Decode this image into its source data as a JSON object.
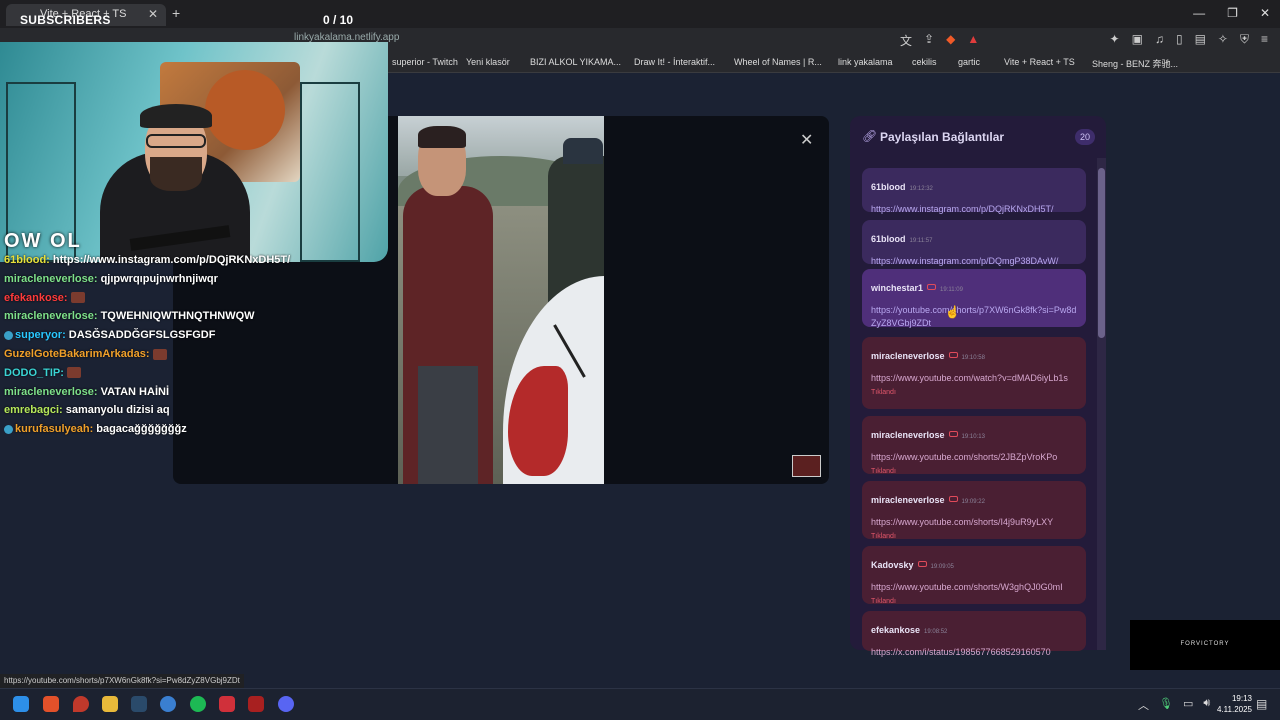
{
  "browser": {
    "tab_title": "Vite + React + TS",
    "url": "linkyakalama.netlify.app",
    "status_url": "https://youtube.com/shorts/p7XW6nGk8fk?si=Pw8dZyZ8VGbj9ZDt"
  },
  "overlay": {
    "subscribers_label": "SUBSCRIBERS",
    "counter": "0 / 10",
    "webcam_text": "OW OL",
    "corner_brand": "FORVICTORY"
  },
  "bookmarks": [
    {
      "label": "superior - Twitch"
    },
    {
      "label": "Yeni klasör"
    },
    {
      "label": "BIZI ALKOL YIKAMA..."
    },
    {
      "label": "Draw It! - İnteraktif..."
    },
    {
      "label": "Wheel of Names | R..."
    },
    {
      "label": "link yakalama"
    },
    {
      "label": "cekilis"
    },
    {
      "label": "gartic"
    },
    {
      "label": "Vite + React + TS"
    },
    {
      "label": "Sheng - BENZ 奔驰..."
    }
  ],
  "chat": [
    {
      "user": "61blood:",
      "msg": "https://www.instagram.com/p/DQjRKNxDH5T/",
      "color": "#e8e03a"
    },
    {
      "user": "miracleneverlose:",
      "msg": "qjıpwrqıpujnwrhnjiwqr",
      "color": "#7ee08a"
    },
    {
      "user": "efekankose:",
      "msg": "",
      "color": "#ff3b3b",
      "emote": true
    },
    {
      "user": "miracleneverlose:",
      "msg": "TQWEHNIQWTHNQTHNWQW",
      "color": "#7ee08a"
    },
    {
      "user": "superyor:",
      "msg": "DASĞSADDĞGFSLGSFGDF",
      "color": "#29c7ff",
      "badge": true
    },
    {
      "user": "GuzelGoteBakarimArkadas:",
      "msg": "",
      "color": "#f0a02a",
      "emote": true
    },
    {
      "user": "DODO_TIP:",
      "msg": "",
      "color": "#3ad4d4",
      "emote": true
    },
    {
      "user": "miracleneverlose:",
      "msg": "VATAN HAİNİ",
      "color": "#7ee08a"
    },
    {
      "user": "emrebagci:",
      "msg": "samanyolu dizisi aq",
      "color": "#b6e85a"
    },
    {
      "user": "kurufasulyeah:",
      "msg": "bagacağğğğğğğz",
      "color": "#f0a02a",
      "badge": true
    }
  ],
  "panel": {
    "title": "Paylaşılan Bağlantılar",
    "count": "20",
    "clicked_label": "Tıklandı",
    "cards": [
      {
        "user": "61blood",
        "time": "19:12:32",
        "url": "https://www.instagram.com/p/DQjRKNxDH5T/",
        "yt": false,
        "clicked": false,
        "style": "purple"
      },
      {
        "user": "61blood",
        "time": "19:11:57",
        "url": "https://www.instagram.com/p/DQmgP38DAvW/",
        "yt": false,
        "clicked": false,
        "style": "purple"
      },
      {
        "user": "winchestar1",
        "time": "19:11:09",
        "url": "https://youtube.com/shorts/p7XW6nGk8fk?si=Pw8dZyZ8VGbj9ZDt",
        "yt": true,
        "clicked": false,
        "style": "purple active"
      },
      {
        "user": "miracleneverlose",
        "time": "19:10:58",
        "url": "https://www.youtube.com/watch?v=dMAD6iyLb1s",
        "yt": true,
        "clicked": true,
        "style": "red"
      },
      {
        "user": "miracleneverlose",
        "time": "19:10:13",
        "url": "https://www.youtube.com/shorts/2JBZpVroKPo",
        "yt": true,
        "clicked": true,
        "style": "red"
      },
      {
        "user": "miracleneverlose",
        "time": "19:09:22",
        "url": "https://www.youtube.com/shorts/I4j9uR9yLXY",
        "yt": true,
        "clicked": true,
        "style": "red"
      },
      {
        "user": "Kadovsky",
        "time": "19:09:05",
        "url": "https://www.youtube.com/shorts/W3ghQJ0G0mI",
        "yt": true,
        "clicked": true,
        "style": "red"
      },
      {
        "user": "efekankose",
        "time": "19:08:52",
        "url": "https://x.com/i/status/1985677668529160570",
        "yt": false,
        "clicked": false,
        "style": "red"
      }
    ]
  },
  "clock": {
    "time": "19:13",
    "date": "4.11.2025"
  }
}
